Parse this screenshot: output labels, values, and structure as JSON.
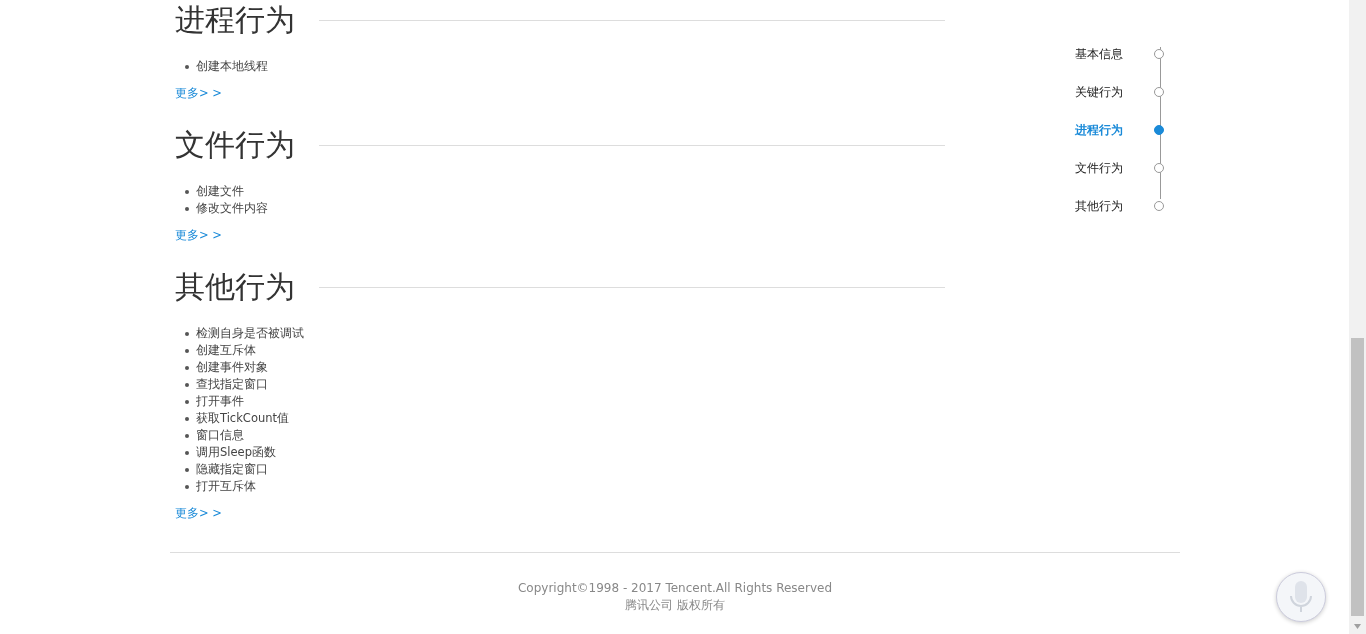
{
  "sections": [
    {
      "title": "进程行为",
      "items": [
        "创建本地线程"
      ],
      "more": "更多> >"
    },
    {
      "title": "文件行为",
      "items": [
        "创建文件",
        "修改文件内容"
      ],
      "more": "更多> >"
    },
    {
      "title": "其他行为",
      "items": [
        "检测自身是否被调试",
        "创建互斥体",
        "创建事件对象",
        "查找指定窗口",
        "打开事件",
        "获取TickCount值",
        "窗口信息",
        "调用Sleep函数",
        "隐藏指定窗口",
        "打开互斥体"
      ],
      "more": "更多> >"
    }
  ],
  "nav": [
    {
      "label": "基本信息",
      "selected": false
    },
    {
      "label": "关键行为",
      "selected": false
    },
    {
      "label": "进程行为",
      "selected": true
    },
    {
      "label": "文件行为",
      "selected": false
    },
    {
      "label": "其他行为",
      "selected": false
    }
  ],
  "footer": {
    "copyright": "Copyright©1998 - 2017 Tencent.All Rights Reserved",
    "company": "腾讯公司 版权所有"
  }
}
